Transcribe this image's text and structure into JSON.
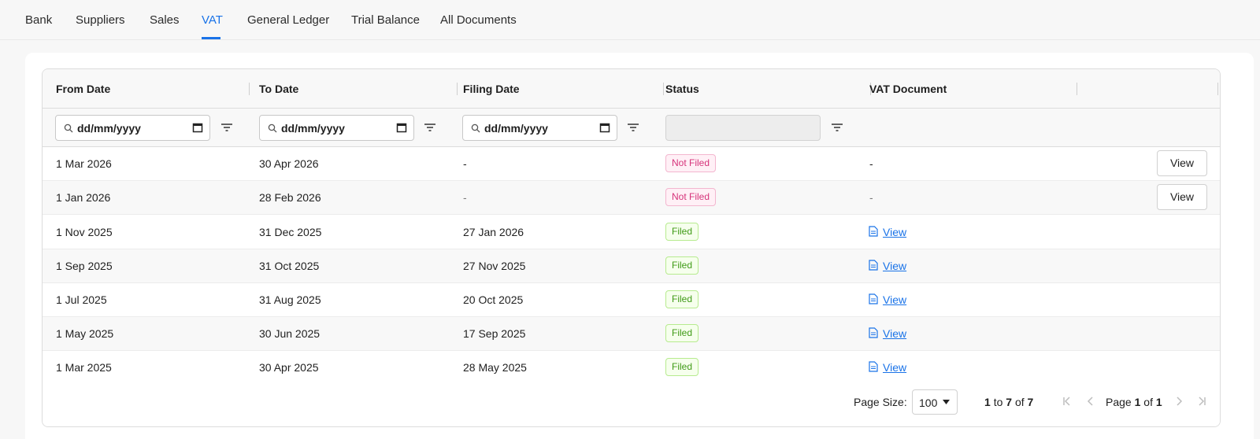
{
  "tabs": [
    {
      "label": "Bank",
      "active": false
    },
    {
      "label": "Suppliers",
      "active": false
    },
    {
      "label": "Sales",
      "active": false
    },
    {
      "label": "VAT",
      "active": true
    },
    {
      "label": "General Ledger",
      "active": false
    },
    {
      "label": "Trial Balance",
      "active": false
    },
    {
      "label": "All Documents",
      "active": false
    }
  ],
  "columns": [
    "From Date",
    "To Date",
    "Filing Date",
    "Status",
    "VAT Document"
  ],
  "filters": {
    "from_date_placeholder": "dd/mm/yyyy",
    "to_date_placeholder": "dd/mm/yyyy",
    "filing_date_placeholder": "dd/mm/yyyy",
    "status_value": ""
  },
  "rows": [
    {
      "from": "1 Mar 2026",
      "to": "30 Apr 2026",
      "filing": "-",
      "status": "Not Filed",
      "document": "-",
      "action": "View"
    },
    {
      "from": "1 Jan 2026",
      "to": "28 Feb 2026",
      "filing": "-",
      "status": "Not Filed",
      "document": "-",
      "action": "View"
    },
    {
      "from": "1 Nov 2025",
      "to": "31 Dec 2025",
      "filing": "27 Jan 2026",
      "status": "Filed",
      "document": "View",
      "action": ""
    },
    {
      "from": "1 Sep 2025",
      "to": "31 Oct 2025",
      "filing": "27 Nov 2025",
      "status": "Filed",
      "document": "View",
      "action": ""
    },
    {
      "from": "1 Jul 2025",
      "to": "31 Aug 2025",
      "filing": "20 Oct 2025",
      "status": "Filed",
      "document": "View",
      "action": ""
    },
    {
      "from": "1 May 2025",
      "to": "30 Jun 2025",
      "filing": "17 Sep 2025",
      "status": "Filed",
      "document": "View",
      "action": ""
    },
    {
      "from": "1 Mar 2025",
      "to": "30 Apr 2025",
      "filing": "28 May 2025",
      "status": "Filed",
      "document": "View",
      "action": ""
    }
  ],
  "footer": {
    "page_size_label": "Page Size:",
    "page_size_value": "100",
    "range_start": "1",
    "range_to": "to",
    "range_end": "7",
    "range_of": "of",
    "range_total": "7",
    "page_word": "Page",
    "page_current": "1",
    "page_of": "of",
    "page_total": "1"
  },
  "colors": {
    "accent": "#1a73e8",
    "not_filed": "#d6337a",
    "filed": "#3f9a16"
  },
  "icons": {
    "search": "search-icon",
    "calendar": "calendar-icon",
    "filter": "filter-icon",
    "document": "document-icon",
    "first_page": "first-page-icon",
    "prev_page": "prev-page-icon",
    "next_page": "next-page-icon",
    "last_page": "last-page-icon"
  }
}
